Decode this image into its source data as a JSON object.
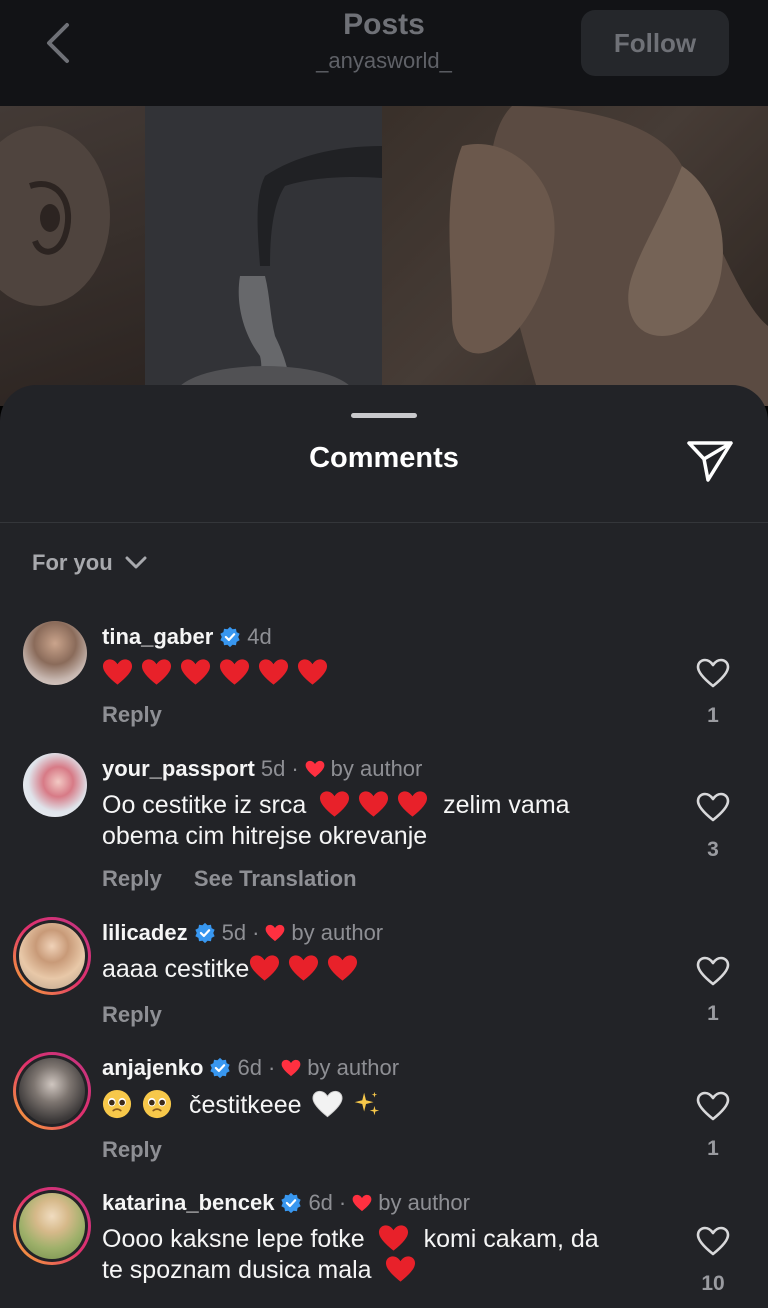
{
  "header": {
    "title": "Posts",
    "subtitle": "_anyasworld_",
    "follow_label": "Follow"
  },
  "sheet": {
    "title": "Comments",
    "sort_label": "For you"
  },
  "comments": [
    {
      "username": "tina_gaber",
      "verified": true,
      "age": "4d",
      "by_author": "",
      "text": "",
      "emoji": "❤️❤️❤️❤️❤️❤️",
      "reply_label": "Reply",
      "translation_label": "",
      "likes": "1"
    },
    {
      "username": "your_passport",
      "verified": false,
      "age": "5d",
      "by_author": "by author",
      "text_part1": "Oo cestitke iz srca",
      "text_part2": "zelim vama",
      "text_line2": "obema cim hitrejse okrevanje",
      "reply_label": "Reply",
      "translation_label": "See Translation",
      "likes": "3"
    },
    {
      "username": "lilicadez",
      "verified": true,
      "age": "5d",
      "by_author": "by author",
      "text": "aaaa cestitke",
      "reply_label": "Reply",
      "likes": "1"
    },
    {
      "username": "anjajenko",
      "verified": true,
      "age": "6d",
      "by_author": "by author",
      "text": "čestitkeee",
      "reply_label": "Reply",
      "likes": "1"
    },
    {
      "username": "katarina_bencek",
      "verified": true,
      "age": "6d",
      "by_author": "by author",
      "text_part1": "Oooo kaksne lepe fotke",
      "text_part2": "komi cakam, da",
      "text_line2": "te spoznam dusica mala",
      "likes": "10"
    }
  ],
  "colors": {
    "background": "#222327",
    "verified_blue": "#3897f0",
    "heart_red": "#ff3040",
    "muted_text": "#8e8f94"
  },
  "icons": {
    "back": "chevron-left-icon",
    "share": "paper-plane-icon",
    "sort": "chevron-down-icon",
    "like": "heart-outline-icon",
    "verified": "verified-badge-icon"
  }
}
